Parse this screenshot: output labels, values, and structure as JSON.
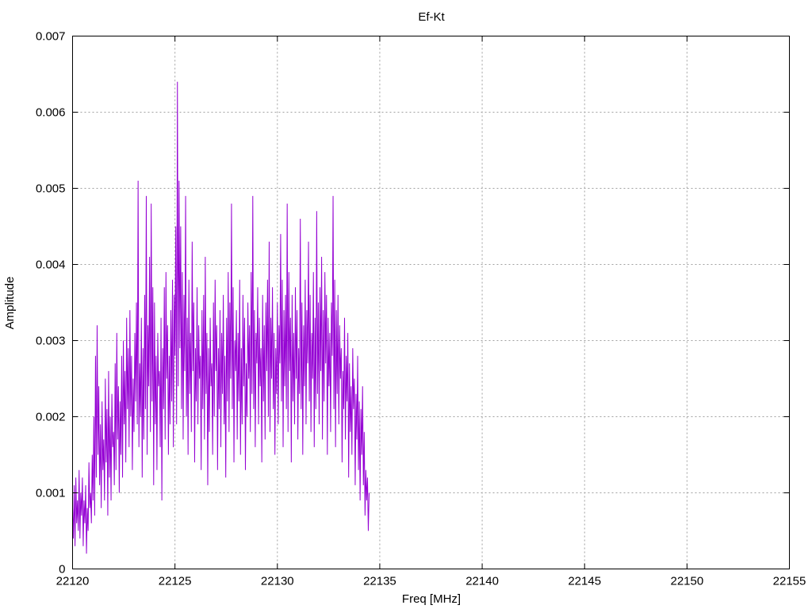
{
  "chart_data": {
    "type": "line",
    "title": "Ef-Kt",
    "xlabel": "Freq [MHz]",
    "ylabel": "Amplitude",
    "xlim": [
      22120,
      22155
    ],
    "ylim": [
      0,
      0.007
    ],
    "x_ticks": [
      "22120",
      "22125",
      "22130",
      "22135",
      "22140",
      "22145",
      "22150",
      "22155"
    ],
    "y_ticks": [
      "0",
      "0.001",
      "0.002",
      "0.003",
      "0.004",
      "0.005",
      "0.006",
      "0.007"
    ],
    "grid": true,
    "series": [
      {
        "color": "#9400d3",
        "x_start": 22120,
        "x_step": 0.04,
        "values": [
          0.0008,
          0.0004,
          0.0011,
          0.0003,
          0.0012,
          0.0006,
          0.0009,
          0.0005,
          0.0013,
          0.0004,
          0.001,
          0.0007,
          0.0012,
          0.0003,
          0.0009,
          0.0006,
          0.0011,
          0.0002,
          0.0008,
          0.0005,
          0.0014,
          0.0008,
          0.001,
          0.0006,
          0.0015,
          0.0009,
          0.002,
          0.0007,
          0.0028,
          0.0012,
          0.0032,
          0.0015,
          0.0024,
          0.0011,
          0.0019,
          0.0008,
          0.0022,
          0.0013,
          0.0017,
          0.0009,
          0.0025,
          0.0014,
          0.0021,
          0.0007,
          0.0026,
          0.0012,
          0.002,
          0.0009,
          0.0023,
          0.0016,
          0.0018,
          0.0011,
          0.0027,
          0.0013,
          0.0031,
          0.0017,
          0.0024,
          0.001,
          0.0022,
          0.0015,
          0.0028,
          0.0012,
          0.003,
          0.0019,
          0.0026,
          0.0014,
          0.0033,
          0.0021,
          0.0029,
          0.0016,
          0.0034,
          0.002,
          0.0028,
          0.0013,
          0.0025,
          0.0018,
          0.0031,
          0.0022,
          0.0035,
          0.0019,
          0.0051,
          0.0016,
          0.0027,
          0.002,
          0.0033,
          0.0012,
          0.0029,
          0.0017,
          0.0036,
          0.0021,
          0.0049,
          0.0015,
          0.0032,
          0.0024,
          0.0041,
          0.0018,
          0.0048,
          0.0022,
          0.0037,
          0.0011,
          0.0035,
          0.0019,
          0.0028,
          0.0013,
          0.0031,
          0.0024,
          0.0026,
          0.0016,
          0.0033,
          0.0009,
          0.0029,
          0.0021,
          0.0037,
          0.0017,
          0.0039,
          0.0025,
          0.0032,
          0.0015,
          0.0028,
          0.0019,
          0.0034,
          0.0022,
          0.0038,
          0.0016,
          0.0036,
          0.0028,
          0.0045,
          0.0019,
          0.0064,
          0.0024,
          0.0051,
          0.0029,
          0.0045,
          0.0021,
          0.0039,
          0.0017,
          0.0036,
          0.0026,
          0.0049,
          0.002,
          0.0033,
          0.0015,
          0.0038,
          0.0023,
          0.0031,
          0.0018,
          0.0043,
          0.0026,
          0.0035,
          0.0014,
          0.0029,
          0.0022,
          0.0037,
          0.0019,
          0.0032,
          0.0025,
          0.0028,
          0.0013,
          0.0034,
          0.0021,
          0.0036,
          0.0017,
          0.0041,
          0.0023,
          0.0031,
          0.0011,
          0.0029,
          0.0018,
          0.0033,
          0.0024,
          0.0027,
          0.0015,
          0.0035,
          0.002,
          0.0038,
          0.0026,
          0.0032,
          0.0013,
          0.0029,
          0.0021,
          0.0034,
          0.0016,
          0.0031,
          0.0023,
          0.0036,
          0.0019,
          0.0028,
          0.0012,
          0.0033,
          0.0022,
          0.0039,
          0.0018,
          0.0035,
          0.0025,
          0.0048,
          0.0021,
          0.0037,
          0.0014,
          0.003,
          0.0026,
          0.0034,
          0.0017,
          0.0031,
          0.0022,
          0.0038,
          0.0015,
          0.0029,
          0.0019,
          0.0036,
          0.0024,
          0.0033,
          0.0013,
          0.0027,
          0.002,
          0.0035,
          0.0025,
          0.0032,
          0.0018,
          0.0039,
          0.0023,
          0.0049,
          0.0021,
          0.0034,
          0.0016,
          0.0031,
          0.0027,
          0.0037,
          0.0019,
          0.0033,
          0.0024,
          0.0029,
          0.0014,
          0.0036,
          0.0022,
          0.0032,
          0.0017,
          0.0035,
          0.0026,
          0.0038,
          0.002,
          0.0043,
          0.0018,
          0.0033,
          0.0025,
          0.0037,
          0.0021,
          0.0031,
          0.0015,
          0.0029,
          0.0023,
          0.0035,
          0.0019,
          0.0032,
          0.0027,
          0.0044,
          0.0022,
          0.0038,
          0.0016,
          0.0034,
          0.0024,
          0.0036,
          0.0021,
          0.0048,
          0.0018,
          0.0039,
          0.0026,
          0.0033,
          0.0014,
          0.0036,
          0.0022,
          0.0031,
          0.0019,
          0.0037,
          0.0025,
          0.0034,
          0.0017,
          0.0029,
          0.0023,
          0.0046,
          0.0021,
          0.0035,
          0.0015,
          0.0032,
          0.0024,
          0.0038,
          0.0019,
          0.0034,
          0.0027,
          0.0043,
          0.0022,
          0.0036,
          0.0018,
          0.0031,
          0.0025,
          0.0039,
          0.0016,
          0.0033,
          0.0021,
          0.0047,
          0.0023,
          0.0035,
          0.0019,
          0.0037,
          0.0026,
          0.0041,
          0.0017,
          0.0034,
          0.0022,
          0.0039,
          0.0027,
          0.0036,
          0.0015,
          0.0033,
          0.0024,
          0.0031,
          0.0018,
          0.0035,
          0.0028,
          0.0049,
          0.0021,
          0.0038,
          0.0016,
          0.0034,
          0.0023,
          0.0036,
          0.0019,
          0.0032,
          0.0025,
          0.0029,
          0.0014,
          0.0026,
          0.0021,
          0.0033,
          0.0017,
          0.0028,
          0.0022,
          0.0031,
          0.0012,
          0.0027,
          0.0018,
          0.0024,
          0.0015,
          0.0029,
          0.0021,
          0.0025,
          0.0011,
          0.0023,
          0.0017,
          0.0028,
          0.0013,
          0.0022,
          0.0009,
          0.0021,
          0.0015,
          0.0024,
          0.0011,
          0.0018,
          0.0007,
          0.0013,
          0.0009,
          0.0012,
          0.0005,
          0.001
        ]
      }
    ]
  }
}
